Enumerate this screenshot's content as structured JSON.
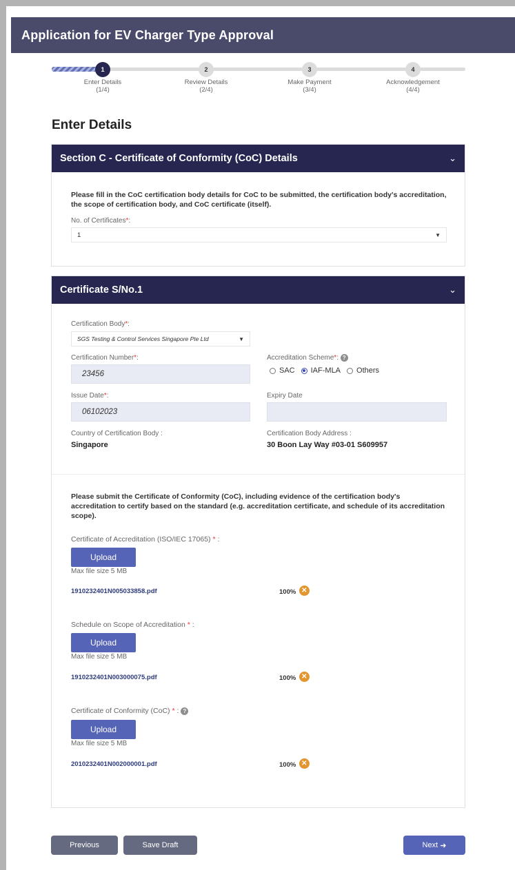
{
  "header": {
    "title": "Application for EV Charger Type Approval"
  },
  "stepper": {
    "steps": [
      {
        "number": "1",
        "label": "Enter Details",
        "count": "(1/4)"
      },
      {
        "number": "2",
        "label": "Review Details",
        "count": "(2/4)"
      },
      {
        "number": "3",
        "label": "Make Payment",
        "count": "(3/4)"
      },
      {
        "number": "4",
        "label": "Acknowledgement",
        "count": "(4/4)"
      }
    ]
  },
  "page": {
    "heading": "Enter Details"
  },
  "section_c": {
    "title": "Section C - Certificate of Conformity (CoC) Details",
    "instruction": "Please fill in the CoC certification body details for CoC to be submitted, the certification body's accreditation, the scope of certification body, and CoC certificate (itself).",
    "num_certificates_label": "No. of Certificates",
    "num_certificates_value": "1"
  },
  "certificate": {
    "title": "Certificate S/No.1",
    "certification_body_label": "Certification Body",
    "certification_body_value": "SGS Testing & Control Services Singapore Pte Ltd",
    "certification_number_label": "Certification Number",
    "certification_number_value": "23456",
    "accreditation_scheme_label": "Accreditation Scheme",
    "scheme_options": [
      "SAC",
      "IAF-MLA",
      "Others"
    ],
    "scheme_selected": "IAF-MLA",
    "issue_date_label": "Issue Date",
    "issue_date_value": "06102023",
    "expiry_date_label": "Expiry Date",
    "expiry_date_value": "",
    "country_label": "Country of Certification Body :",
    "country_value": "Singapore",
    "address_label": "Certification Body Address :",
    "address_value": "30 Boon Lay Way #03-01 S609957",
    "submit_instruction": "Please submit the Certificate of Conformity (CoC), including evidence of the certification body's accreditation to certify based on the standard (e.g. accreditation certificate, and schedule of its accreditation scope).",
    "uploads": [
      {
        "label": "Certificate of Accreditation (ISO/IEC 17065)",
        "button": "Upload",
        "max_size": "Max file size 5 MB",
        "file": "1910232401N005033858.pdf",
        "progress": "100%"
      },
      {
        "label": "Schedule on Scope of Accreditation",
        "button": "Upload",
        "max_size": "Max file size 5 MB",
        "file": "1910232401N003000075.pdf",
        "progress": "100%"
      },
      {
        "label": "Certificate of Conformity (CoC)",
        "button": "Upload",
        "max_size": "Max file size 5 MB",
        "file": "2010232401N002000001.pdf",
        "progress": "100%"
      }
    ]
  },
  "footer": {
    "previous": "Previous",
    "save_draft": "Save Draft",
    "next": "Next"
  },
  "icons": {
    "chevron": "chevron-down-icon",
    "help": "question-circle-icon",
    "remove": "close-circle-icon",
    "next_arrow": "arrow-right-icon"
  },
  "colors": {
    "header_bg": "#4a4a6a",
    "panel_header": "#262650",
    "primary": "#5664b8",
    "remove": "#e3962f"
  }
}
